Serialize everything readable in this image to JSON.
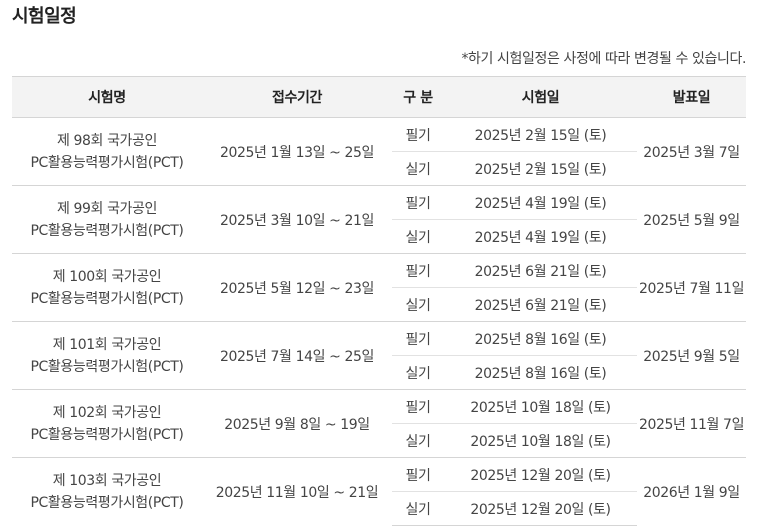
{
  "page_title": "시험일정",
  "notice": "*하기 시험일정은 사정에 따라 변경될 수 있습니다.",
  "table": {
    "headers": [
      "시험명",
      "접수기간",
      "구 분",
      "시험일",
      "발표일"
    ],
    "rows": [
      {
        "round": "제 98회 국가공인",
        "name": "PC활용능력평가시험(PCT)",
        "period": "2025년 1월 13일 ~ 25일",
        "written_label": "필기",
        "written_date": "2025년 2월 15일 (토)",
        "practical_label": "실기",
        "practical_date": "2025년 2월 15일 (토)",
        "result": "2025년 3월 7일"
      },
      {
        "round": "제 99회 국가공인",
        "name": "PC활용능력평가시험(PCT)",
        "period": "2025년 3월 10일 ~ 21일",
        "written_label": "필기",
        "written_date": "2025년 4월 19일 (토)",
        "practical_label": "실기",
        "practical_date": "2025년 4월 19일 (토)",
        "result": "2025년 5월 9일"
      },
      {
        "round": "제 100회 국가공인",
        "name": "PC활용능력평가시험(PCT)",
        "period": "2025년 5월 12일 ~ 23일",
        "written_label": "필기",
        "written_date": "2025년 6월 21일 (토)",
        "practical_label": "실기",
        "practical_date": "2025년 6월 21일 (토)",
        "result": "2025년 7월 11일"
      },
      {
        "round": "제 101회 국가공인",
        "name": "PC활용능력평가시험(PCT)",
        "period": "2025년 7월 14일 ~ 25일",
        "written_label": "필기",
        "written_date": "2025년 8월 16일 (토)",
        "practical_label": "실기",
        "practical_date": "2025년 8월 16일 (토)",
        "result": "2025년 9월 5일"
      },
      {
        "round": "제 102회 국가공인",
        "name": "PC활용능력평가시험(PCT)",
        "period": "2025년 9월 8일 ~ 19일",
        "written_label": "필기",
        "written_date": "2025년 10월 18일 (토)",
        "practical_label": "실기",
        "practical_date": "2025년 10월 18일 (토)",
        "result": "2025년 11월 7일"
      },
      {
        "round": "제 103회 국가공인",
        "name": "PC활용능력평가시험(PCT)",
        "period": "2025년 11월 10일 ~ 21일",
        "written_label": "필기",
        "written_date": "2025년 12월 20일 (토)",
        "practical_label": "실기",
        "practical_date": "2025년 12월 20일 (토)",
        "result": "2026년 1월 9일"
      }
    ]
  }
}
